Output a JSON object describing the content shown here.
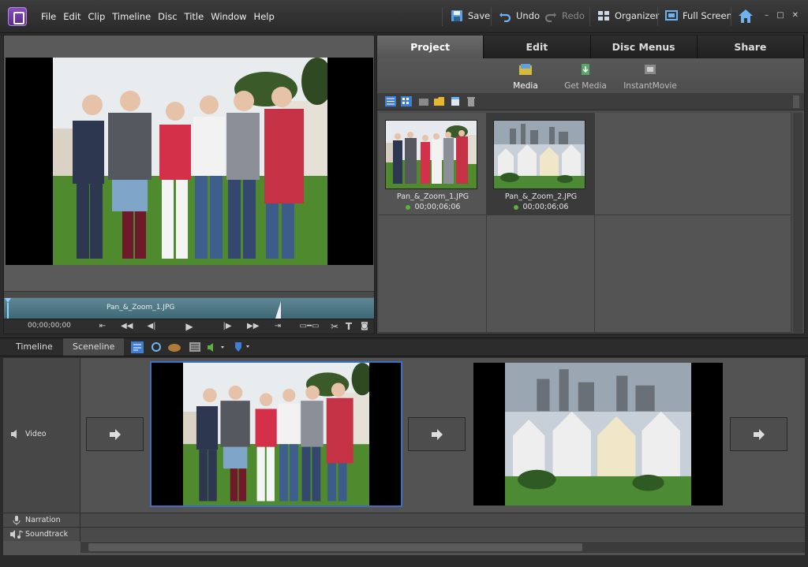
{
  "menu": [
    "File",
    "Edit",
    "Clip",
    "Timeline",
    "Disc",
    "Title",
    "Window",
    "Help"
  ],
  "toolbar": {
    "save": "Save",
    "undo": "Undo",
    "redo": "Redo",
    "organizer": "Organizer",
    "fullscreen": "Full Screen"
  },
  "monitor": {
    "clip_name": "Pan_&_Zoom_1.JPG",
    "timecode": "00;00;00;00"
  },
  "panel": {
    "tabs": [
      "Project",
      "Edit",
      "Disc Menus",
      "Share"
    ],
    "active_tab": "Project",
    "subtools": {
      "media": "Media",
      "get_media": "Get Media",
      "instant_movie": "InstantMovie"
    }
  },
  "media": [
    {
      "name": "Pan_&_Zoom_1.JPG",
      "duration": "00;00;06;06"
    },
    {
      "name": "Pan_&_Zoom_2.JPG",
      "duration": "00;00;06;06"
    }
  ],
  "scene": {
    "tabs": {
      "timeline": "Timeline",
      "sceneline": "Sceneline"
    },
    "tracks": {
      "video": "Video",
      "narration": "Narration",
      "soundtrack": "Soundtrack"
    }
  },
  "colors": {
    "accent": "#3c6fc4",
    "track": "#4f7987",
    "status_dot": "#5cb23a"
  }
}
